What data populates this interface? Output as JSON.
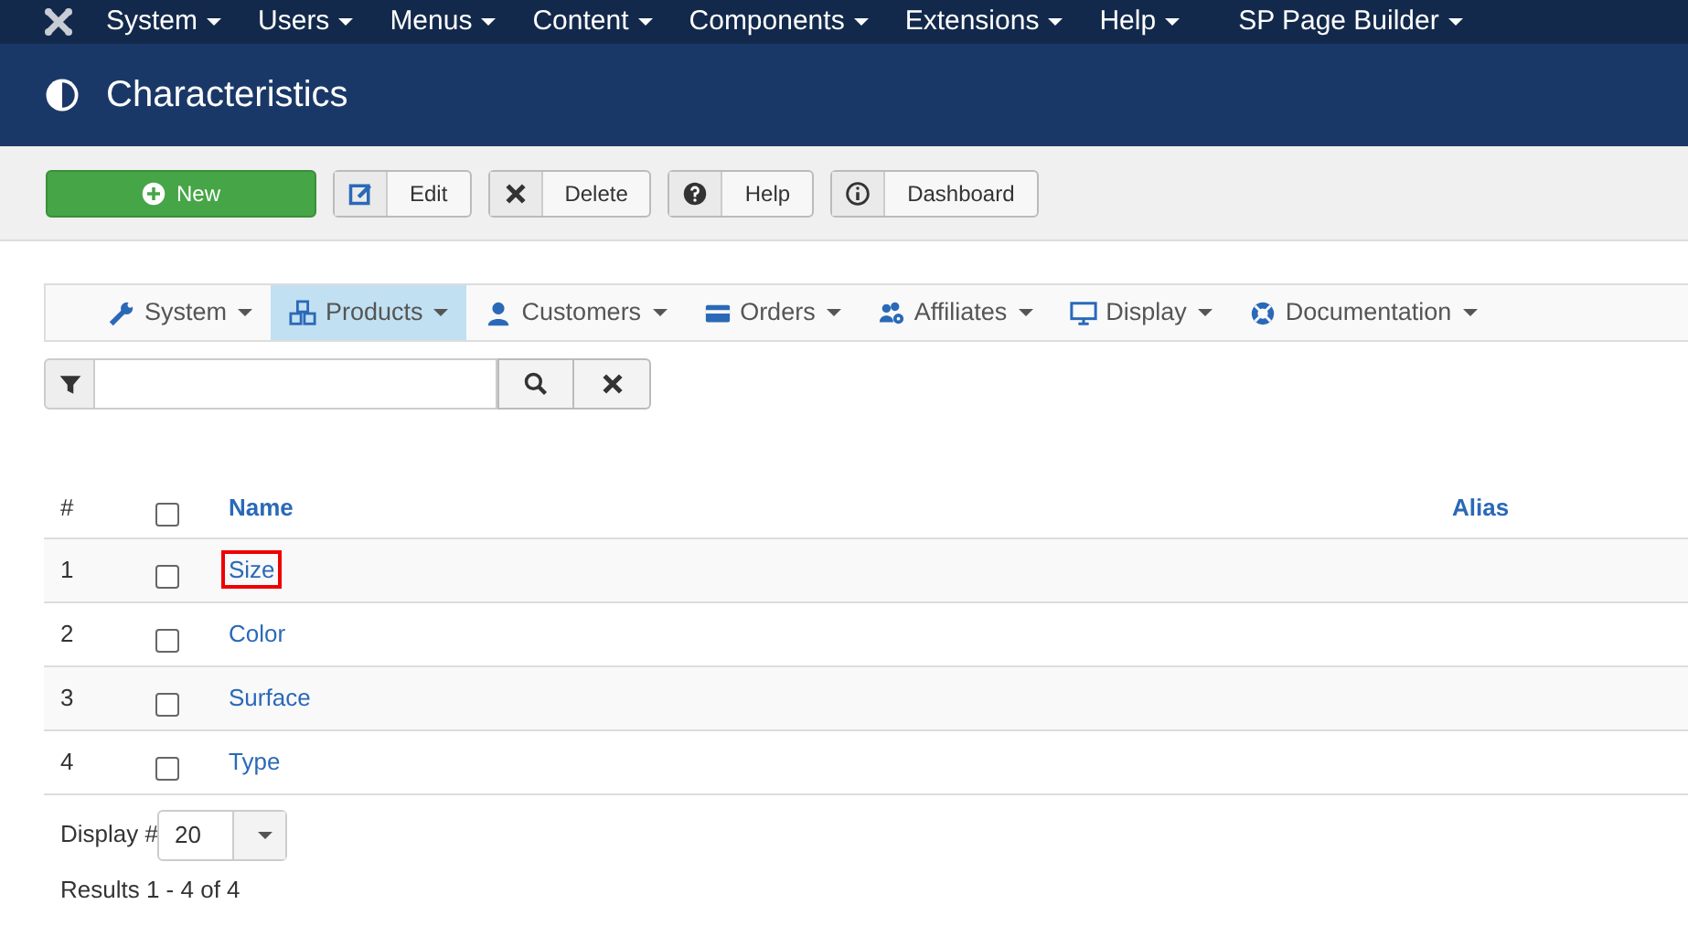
{
  "top_menu": [
    {
      "label": "System"
    },
    {
      "label": "Users"
    },
    {
      "label": "Menus"
    },
    {
      "label": "Content"
    },
    {
      "label": "Components"
    },
    {
      "label": "Extensions"
    },
    {
      "label": "Help"
    },
    {
      "label": "SP Page Builder"
    }
  ],
  "page_title": "Characteristics",
  "toolbar": [
    {
      "label": "New",
      "kind": "primary"
    },
    {
      "label": "Edit",
      "kind": "split"
    },
    {
      "label": "Delete",
      "kind": "split"
    },
    {
      "label": "Help",
      "kind": "split"
    },
    {
      "label": "Dashboard",
      "kind": "split"
    }
  ],
  "sub_menu": [
    {
      "label": "System",
      "selected": false
    },
    {
      "label": "Products",
      "selected": true
    },
    {
      "label": "Customers",
      "selected": false
    },
    {
      "label": "Orders",
      "selected": false
    },
    {
      "label": "Affiliates",
      "selected": false
    },
    {
      "label": "Display",
      "selected": false
    },
    {
      "label": "Documentation",
      "selected": false
    }
  ],
  "table": {
    "columns": [
      "#",
      "Name",
      "Alias"
    ],
    "select_all_checked": false,
    "rows": [
      {
        "number": "1",
        "name": "Size",
        "checked": false,
        "highlighted": true
      },
      {
        "number": "2",
        "name": "Color",
        "checked": false,
        "highlighted": false
      },
      {
        "number": "3",
        "name": "Surface",
        "checked": false,
        "highlighted": false
      },
      {
        "number": "4",
        "name": "Type",
        "checked": false,
        "highlighted": false
      }
    ]
  },
  "pagination": {
    "label": "Display #",
    "value": "20",
    "results": "Results 1 - 4 of 4"
  }
}
